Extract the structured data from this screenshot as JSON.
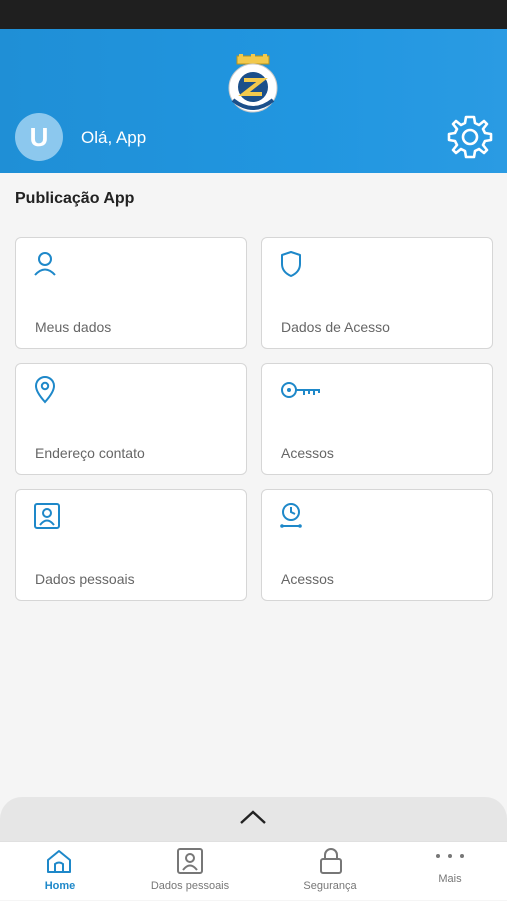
{
  "colors": {
    "accent": "#1f8fd6",
    "icon_blue": "#1e88c9",
    "active_nav": "#1e88c9",
    "inactive_nav": "#777777"
  },
  "header": {
    "avatar_initial": "U",
    "greeting": "Olá, App",
    "settings_icon": "gear-icon",
    "logo_icon": "company-crest-logo"
  },
  "page": {
    "section_title": "Publicação App"
  },
  "cards": [
    {
      "label": "Meus dados",
      "icon": "user-icon"
    },
    {
      "label": "Dados de Acesso",
      "icon": "shield-icon"
    },
    {
      "label": "Endereço contato",
      "icon": "location-pin-icon"
    },
    {
      "label": "Acessos",
      "icon": "key-icon"
    },
    {
      "label": "Dados pessoais",
      "icon": "id-card-icon"
    },
    {
      "label": "Acessos",
      "icon": "clock-timeline-icon"
    }
  ],
  "bottom_nav": {
    "items": [
      {
        "label": "Home",
        "icon": "home-icon",
        "active": true
      },
      {
        "label": "Dados pessoais",
        "icon": "id-card-icon",
        "active": false
      },
      {
        "label": "Segurança",
        "icon": "lock-icon",
        "active": false
      },
      {
        "label": "Mais",
        "icon": "more-dots-icon",
        "active": false
      }
    ]
  }
}
